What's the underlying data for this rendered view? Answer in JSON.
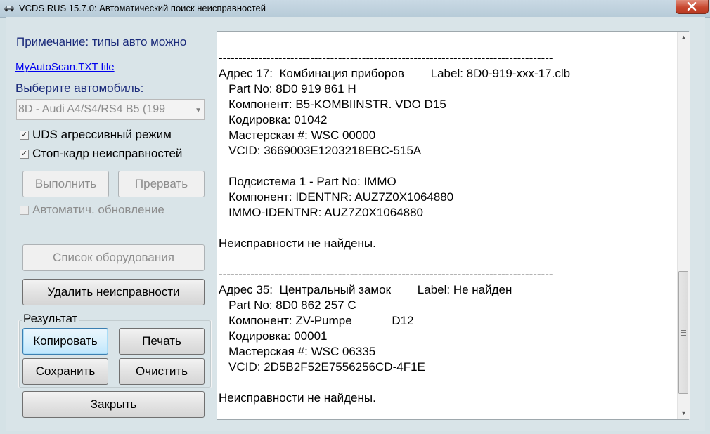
{
  "window": {
    "title": "VCDS RUS 15.7.0:  Автоматический поиск неисправностей"
  },
  "left_panel": {
    "note": "Примечание: типы авто можно редактировать",
    "link": "MyAutoScan.TXT file",
    "select_label": "Выберите автомобиль:",
    "car_select_value": "8D - Audi A4/S4/RS4 B5 (199",
    "uds_checkbox": {
      "label": "UDS агрессивный режим",
      "checked": true
    },
    "freeze_checkbox": {
      "label": "Стоп-кадр неисправностей",
      "checked": true
    },
    "run_button": "Выполнить",
    "abort_button": "Прервать",
    "auto_update_checkbox": {
      "label": "Автоматич. обновление",
      "checked": false
    },
    "equipment_list_button": "Список оборудования",
    "delete_faults_button": "Удалить неисправности",
    "result_group": {
      "label": "Результат",
      "copy_button": "Копировать",
      "print_button": "Печать",
      "save_button": "Сохранить",
      "clear_button": "Очистить"
    },
    "close_button": "Закрыть"
  },
  "log": {
    "lines": [
      "------------------------------------------------------------------------------------",
      "Адрес 17:  Комбинация приборов        Label: 8D0-919-xxx-17.clb",
      "   Part No: 8D0 919 861 H",
      "   Компонент: B5-KOMBIINSTR. VDO D15",
      "   Кодировка: 01042",
      "   Мастерская #: WSC 00000",
      "   VCID: 3669003E1203218EBC-515A",
      "",
      "   Подсистема 1 - Part No: IMMO",
      "   Компонент: IDENTNR: AUZ7Z0X1064880",
      "   IMMO-IDENTNR: AUZ7Z0X1064880",
      "",
      "Неисправности не найдены.",
      "",
      "------------------------------------------------------------------------------------",
      "Адрес 35:  Центральный замок        Label: Не найден",
      "   Part No: 8D0 862 257 C",
      "   Компонент: ZV-Pumpe            D12",
      "   Кодировка: 00001",
      "   Мастерская #: WSC 06335",
      "   VCID: 2D5B2F52E7556256CD-4F1E",
      "",
      "Неисправности не найдены."
    ]
  },
  "scrollbar": {
    "up_icon": "arrow-up-icon",
    "down_icon": "arrow-down-icon"
  }
}
